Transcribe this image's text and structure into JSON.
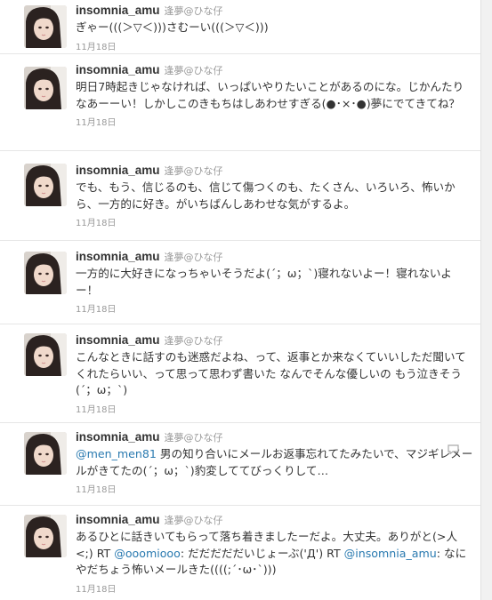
{
  "tweets": [
    {
      "screen_name": "insomnia_amu",
      "full_name": "逢夢@ひな仔",
      "text": "ぎゃー(((＞▽＜)))さむーい(((＞▽＜)))",
      "time": "11月18日"
    },
    {
      "screen_name": "insomnia_amu",
      "full_name": "逢夢@ひな仔",
      "text": "明日7時起きじゃなければ、いっぱいやりたいことがあるのにな。じかんたりなあーーい！しかしこのきもちはしあわせすぎる(●･×･●)夢にでてきてね？",
      "time": "11月18日"
    },
    {
      "screen_name": "insomnia_amu",
      "full_name": "逢夢@ひな仔",
      "text": "でも、もう、信じるのも、信じて傷つくのも、たくさん、いろいろ、怖いから、一方的に好き。がいちばんしあわせな気がするよ。",
      "time": "11月18日"
    },
    {
      "screen_name": "insomnia_amu",
      "full_name": "逢夢@ひな仔",
      "text": "一方的に大好きになっちゃいそうだよ(´；ω；`)寝れないよー！寝れないよー！",
      "time": "11月18日"
    },
    {
      "screen_name": "insomnia_amu",
      "full_name": "逢夢@ひな仔",
      "text": "こんなときに話すのも迷惑だよね、って、返事とか来なくていいしただ聞いてくれたらいい、って思って思わず書いた なんでそんな優しいの もう泣きそう(´；ω；`)",
      "time": "11月18日"
    },
    {
      "screen_name": "insomnia_amu",
      "full_name": "逢夢@ひな仔",
      "mention": "@men_men81",
      "text": " 男の知り合いにメールお返事忘れてたみたいで、マジギレメールがきてたの(´；ω；`)豹変しててびっくりして…",
      "time": "11月18日"
    },
    {
      "screen_name": "insomnia_amu",
      "full_name": "逢夢@ひな仔",
      "text_part1": "あるひとに話きいてもらって落ち着きましたーだよ。大丈夫。ありがと(>人<;) RT ",
      "mention1": "@ooomiooo",
      "text_part2": ": だだだだだいじょーぶ('Д') RT ",
      "mention2": "@insomnia_amu",
      "text_part3": ": なにやだちょう怖いメールきた((((;´･ω･`)))",
      "time": "11月18日"
    }
  ]
}
